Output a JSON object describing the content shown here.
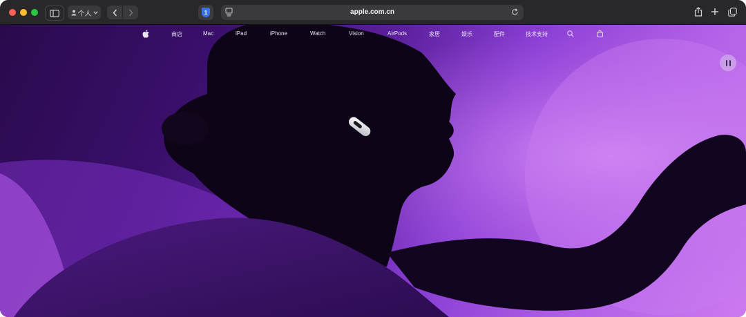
{
  "toolbar": {
    "profile_label": "个人",
    "address": "apple.com.cn"
  },
  "nav": {
    "items": [
      "商店",
      "Mac",
      "iPad",
      "iPhone",
      "Watch",
      "Vision",
      "AirPods",
      "家居",
      "娱乐",
      "配件",
      "技术支持"
    ]
  },
  "icons": {
    "apple": "apple-logo-icon",
    "search": "search-icon",
    "bag": "bag-icon",
    "pause": "pause-icon"
  },
  "colors": {
    "hero_purple": "#8a3fd4",
    "hero_dark": "#2a0a4c",
    "nav_text": "#e9e4f2"
  }
}
